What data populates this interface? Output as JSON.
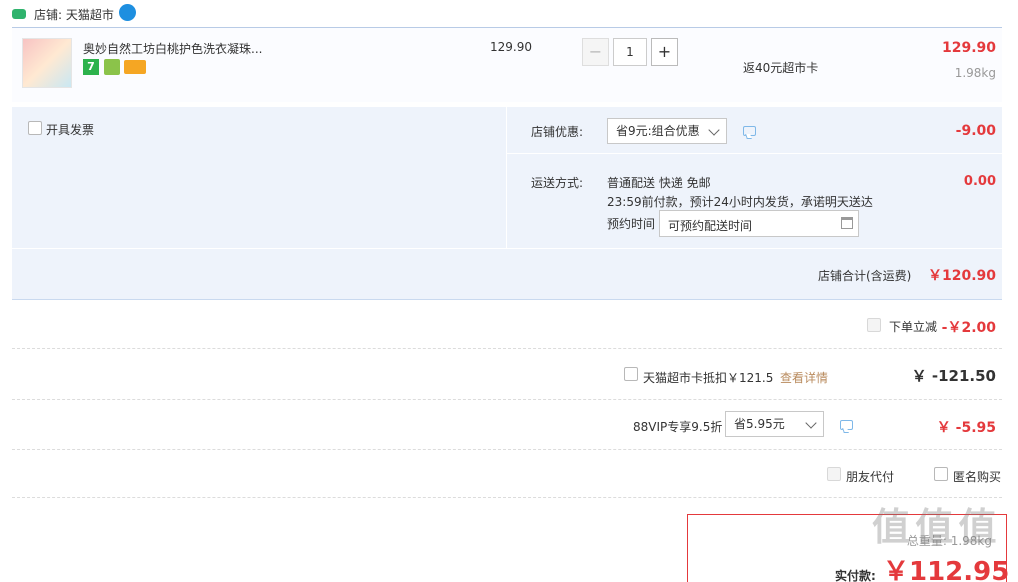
{
  "shop": {
    "label": "店铺: 天猫超市"
  },
  "item": {
    "title": "奥妙自然工坊白桃护色洗衣凝珠...",
    "unit_price": "129.90",
    "quantity": "1",
    "qty_minus": "−",
    "qty_plus": "+",
    "rebate": "返40元超市卡",
    "total": "129.90",
    "weight": "1.98kg",
    "badge_seven": "7"
  },
  "invoice": {
    "label": "开具发票"
  },
  "discount": {
    "label": "店铺优惠:",
    "selected": "省9元:组合优惠",
    "amount": "-9.00"
  },
  "delivery": {
    "label": "运送方式:",
    "line1": "普通配送 快递 免邮",
    "line2": "23:59前付款，预计24小时内发货，承诺明天送达",
    "schedule_label": "预约时间",
    "schedule_value": "可预约配送时间",
    "amount": "0.00"
  },
  "shop_total": {
    "label": "店铺合计(含运费)",
    "amount": "￥120.90"
  },
  "order_reduce": {
    "label": "下单立减",
    "amount": "-￥2.00"
  },
  "card": {
    "label": "天猫超市卡抵扣￥121.5",
    "link": "查看详情",
    "amount": "￥ -121.50"
  },
  "vip": {
    "label": "88VIP专享9.5折",
    "selected": "省5.95元",
    "amount": "￥ -5.95"
  },
  "friend_pay": {
    "label": "朋友代付"
  },
  "anonymous": {
    "label": "匿名购买"
  },
  "summary": {
    "weight": "总重量: 1.98kg",
    "pay_label": "实付款:",
    "pay_amount": "￥112.95"
  },
  "watermark": {
    "text": "值 值 值"
  },
  "colors": {
    "accent_red": "#e4393c",
    "panel_blue": "#eef3fb",
    "border_blue": "#c9d9ef"
  }
}
